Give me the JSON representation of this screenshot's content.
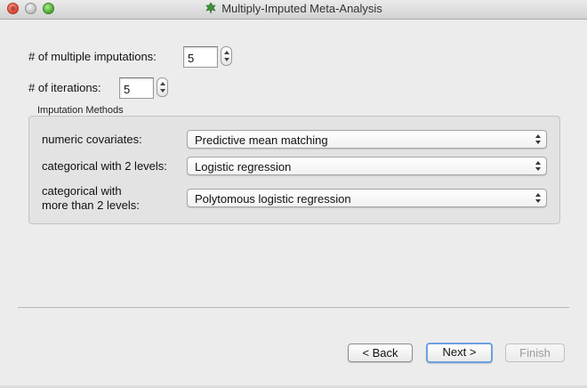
{
  "window": {
    "title": "Multiply-Imputed Meta-Analysis",
    "app_icon": "leaf-icon"
  },
  "imputation": {
    "multiple_label": "# of multiple imputations:",
    "multiple_value": "5",
    "iterations_label": "# of iterations:",
    "iterations_value": "5"
  },
  "methods": {
    "group_title": "Imputation Methods",
    "rows": [
      {
        "label_line1": "numeric covariates:",
        "label_line2": "",
        "value": "Predictive mean matching"
      },
      {
        "label_line1": "categorical with 2 levels:",
        "label_line2": "",
        "value": "Logistic regression"
      },
      {
        "label_line1": "categorical with",
        "label_line2": "more than 2 levels:",
        "value": "Polytomous logistic regression"
      }
    ]
  },
  "buttons": {
    "back": "< Back",
    "next": "Next >",
    "finish": "Finish"
  },
  "colors": {
    "default_button_ring": "#6ca0df",
    "close": "#d9402f",
    "zoom": "#4aa32e"
  }
}
